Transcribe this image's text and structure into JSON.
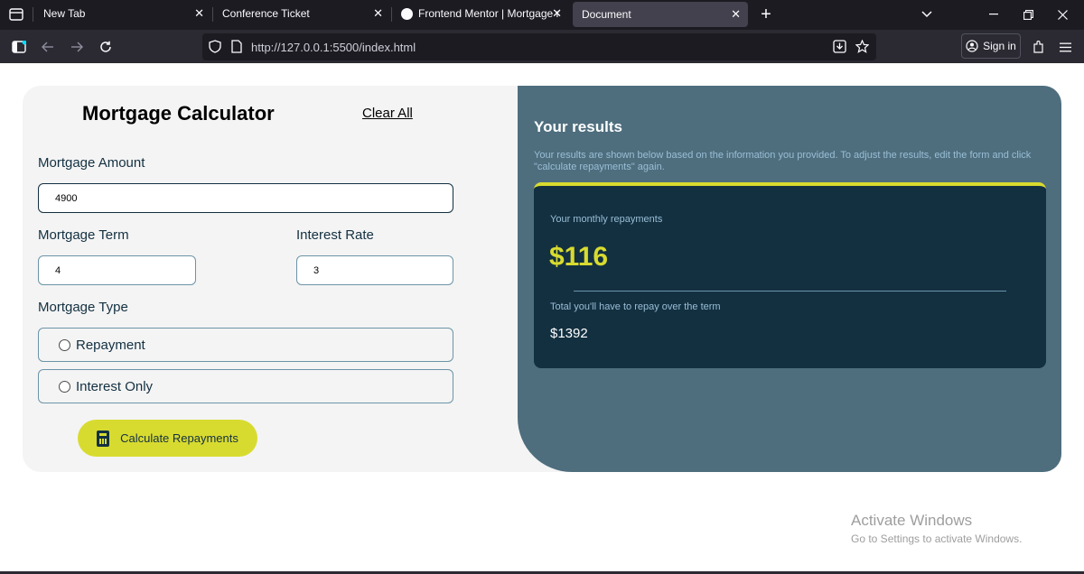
{
  "browser": {
    "tabs": [
      {
        "label": "New Tab",
        "close": "✕"
      },
      {
        "label": "Conference Ticket",
        "close": "✕"
      },
      {
        "label": "Frontend Mentor | Mortgage re",
        "close": "✕"
      },
      {
        "label": "Document",
        "close": "✕"
      }
    ],
    "new_tab": "+",
    "url": "http://127.0.0.1:5500/index.html",
    "sign_in": "Sign in"
  },
  "form": {
    "title": "Mortgage Calculator",
    "clear_all": "Clear All",
    "amount_label": "Mortgage Amount",
    "amount_value": "4900",
    "term_label": "Mortgage Term",
    "term_value": "4",
    "rate_label": "Interest Rate",
    "rate_value": "3",
    "type_label": "Mortgage Type",
    "type_options": [
      "Repayment",
      "Interest Only"
    ],
    "calculate_label": "Calculate Repayments"
  },
  "results": {
    "title": "Your results",
    "description": "Your results are shown below based on the information you provided. To adjust the results, edit the form and click \"calculate repayments\" again.",
    "monthly_label": "Your monthly repayments",
    "monthly_value": "$116",
    "total_label": "Total you'll have to repay over the term",
    "total_value": "$1392"
  },
  "watermark": {
    "title": "Activate Windows",
    "subtitle": "Go to Settings to activate Windows."
  },
  "colors": {
    "accent_lime": "#d8db2f",
    "slate_900": "#133041",
    "slate_700": "#4e6e7e",
    "slate_300": "#9abed5"
  }
}
